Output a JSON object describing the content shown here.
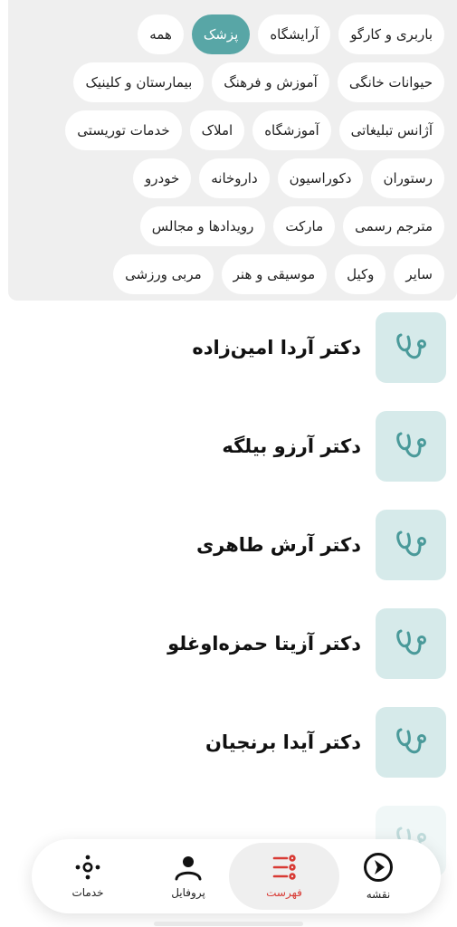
{
  "filters": {
    "rows": [
      [
        "همه",
        "پزشک",
        "آرایشگاه",
        "باربری و کارگو"
      ],
      [
        "بیمارستان و کلینیک",
        "آموزش و فرهنگ",
        "حیوانات خانگی"
      ],
      [
        "خدمات توریستی",
        "املاک",
        "آموزشگاه",
        "آژانس تبلیغاتی"
      ],
      [
        "خودرو",
        "داروخانه",
        "دکوراسیون",
        "رستوران"
      ],
      [
        "رویدادها و مجالس",
        "مارکت",
        "مترجم رسمی"
      ],
      [
        "مربی ورزشی",
        "موسیقی و هنر",
        "وکیل",
        "سایر"
      ]
    ],
    "active": "پزشک",
    "active_color": "#58a6a6"
  },
  "list": {
    "items": [
      "دکتر آردا امین‌زاده",
      "دکتر آرزو بیلگه",
      "دکتر آرش طاهری",
      "دکتر آزیتا حمزه‌اوغلو",
      "دکتر آیدا برنجیان"
    ],
    "item_icon": "stethoscope-icon"
  },
  "nav": {
    "map": "نقشه",
    "list": "فهرست",
    "profile": "پروفایل",
    "services": "خدمات",
    "active": "list",
    "active_color": "#d83a34"
  }
}
